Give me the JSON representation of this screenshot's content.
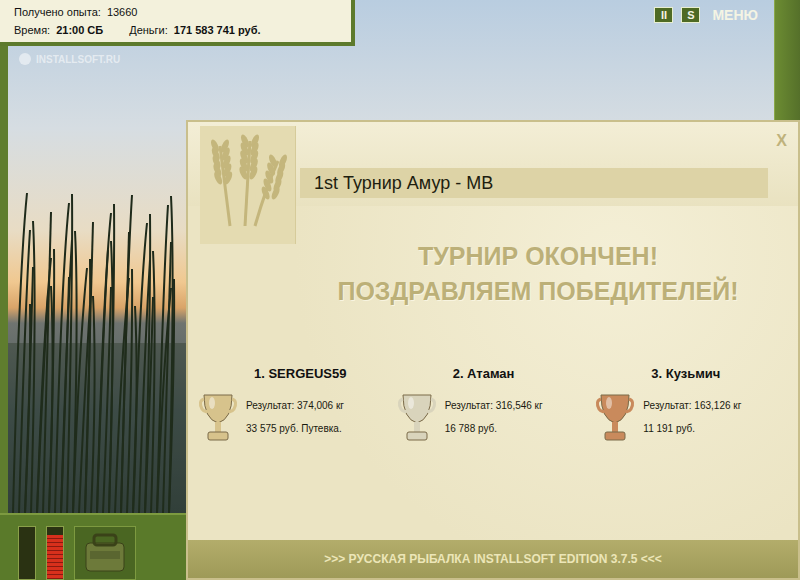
{
  "hud": {
    "experience_label": "Получено опыта:",
    "experience": "13660",
    "time_label": "Время:",
    "time": "21:00 СБ",
    "money_label": "Деньги:",
    "money": "171 583 741 руб."
  },
  "watermark": "INSTALLSOFT.RU",
  "toolbar": [
    {
      "label": "II"
    },
    {
      "label": "S"
    },
    {
      "label": "МЕНЮ"
    }
  ],
  "gauges": [
    {
      "level": 0.0
    },
    {
      "level": 0.85
    }
  ],
  "dialog": {
    "title": "1st Турнир Амур - МВ",
    "close": "X",
    "headline": [
      "ТУРНИР ОКОНЧЕН!",
      "ПОЗДРАВЛЯЕМ ПОБЕДИТЕЛЕЙ!"
    ],
    "winners": [
      {
        "place": "1. SERGEUS59",
        "result": "Результат: 374,006 кг",
        "prize": "33 575 руб. Путевка.",
        "color": "#d7c38c"
      },
      {
        "place": "2. Атаман",
        "result": "Результат: 316,546 кг",
        "prize": "16 788 руб.",
        "color": "#d9d4bc"
      },
      {
        "place": "3. Кузьмич",
        "result": "Результат: 163,126 кг",
        "prize": "11 191 руб.",
        "color": "#c98a5c"
      }
    ],
    "footer": ">>> РУССКАЯ РЫБАЛКА INSTALLSOFT EDITION 3.7.5 <<<"
  }
}
